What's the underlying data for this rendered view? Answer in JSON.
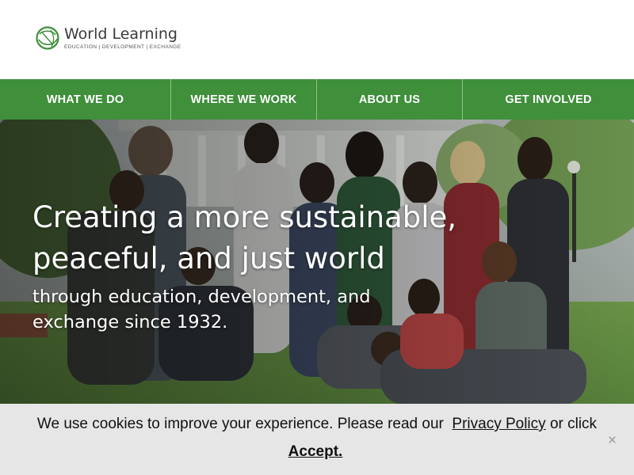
{
  "header": {
    "logo_name": "World Learning",
    "logo_tagline": "EDUCATION | DEVELOPMENT | EXCHANGE",
    "brand_color": "#3f8f3b"
  },
  "nav": {
    "items": [
      {
        "label": "WHAT WE DO"
      },
      {
        "label": "WHERE WE WORK"
      },
      {
        "label": "ABOUT US"
      },
      {
        "label": "GET INVOLVED"
      }
    ]
  },
  "hero": {
    "title": "Creating a more sustainable, peaceful, and just world",
    "subtitle": "through education, development, and exchange since 1932.",
    "image": "group-of-students-photo"
  },
  "cookie_bar": {
    "text_before": "We use cookies to improve your experience. Please read our",
    "privacy_link": "Privacy Policy",
    "text_after": "or click",
    "accept_label": "Accept.",
    "close_symbol": "×",
    "background": "#e6e6e6"
  }
}
